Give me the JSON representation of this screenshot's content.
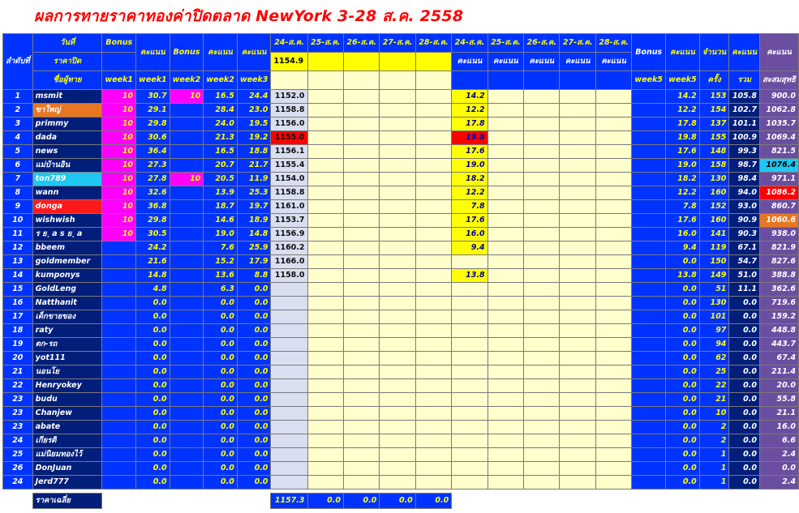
{
  "title": "ผลการทายราคาทองค่าปิดตลาด NewYork 3-28 ส.ค. 2558",
  "headers": {
    "rank": "ลำดับที่",
    "date_label": "วันที่",
    "close_price_label": "ราคาปิด",
    "member_label": "ชื่อผู้ทาย",
    "bonus": "Bonus",
    "score": "คะแนน",
    "week1": "week1",
    "week2": "week2",
    "week3": "week3",
    "week5": "week5",
    "dates": [
      "24-ส.ค.",
      "25-ส.ค.",
      "26-ส.ค.",
      "27-ส.ค.",
      "28-ส.ค."
    ],
    "close_prices": [
      "1154.9",
      "",
      "",
      "",
      ""
    ],
    "count": "จำนวน",
    "times": "ครั้ง",
    "total": "รวม",
    "cumulative": "สะสมสุทธิ"
  },
  "rows": [
    {
      "no": "1",
      "name": "msmit",
      "b1": "10",
      "w1": "30.7",
      "b2": "10",
      "w2": "16.5",
      "w3": "24.4",
      "p": "1152.0",
      "s": "14.2",
      "w5": "14.2",
      "cnt": "153",
      "tot": "105.8",
      "cum": "900.0"
    },
    {
      "no": "2",
      "name": "ขาใหญ่",
      "b1": "10",
      "w1": "29.1",
      "b2": "",
      "w2": "28.4",
      "w3": "23.0",
      "p": "1158.8",
      "s": "12.2",
      "w5": "12.2",
      "cnt": "154",
      "tot": "102.7",
      "cum": "1062.8"
    },
    {
      "no": "3",
      "name": "primmy",
      "b1": "10",
      "w1": "29.8",
      "b2": "",
      "w2": "24.0",
      "w3": "19.5",
      "p": "1156.0",
      "s": "17.8",
      "w5": "17.8",
      "cnt": "137",
      "tot": "101.1",
      "cum": "1035.7"
    },
    {
      "no": "4",
      "name": "dada",
      "b1": "10",
      "w1": "30.6",
      "b2": "",
      "w2": "21.3",
      "w3": "19.2",
      "p": "1155.0",
      "s": "19.8",
      "w5": "19.8",
      "cnt": "155",
      "tot": "100.9",
      "cum": "1069.4"
    },
    {
      "no": "5",
      "name": "news",
      "b1": "10",
      "w1": "36.4",
      "b2": "",
      "w2": "16.5",
      "w3": "18.8",
      "p": "1156.1",
      "s": "17.6",
      "w5": "17.6",
      "cnt": "148",
      "tot": "99.3",
      "cum": "821.5"
    },
    {
      "no": "6",
      "name": "แม่บ้านอิน",
      "b1": "10",
      "w1": "27.3",
      "b2": "",
      "w2": "20.7",
      "w3": "21.7",
      "p": "1155.4",
      "s": "19.0",
      "w5": "19.0",
      "cnt": "158",
      "tot": "98.7",
      "cum": "1076.4"
    },
    {
      "no": "7",
      "name": "ton789",
      "b1": "10",
      "w1": "27.8",
      "b2": "10",
      "w2": "20.5",
      "w3": "11.9",
      "p": "1154.0",
      "s": "18.2",
      "w5": "18.2",
      "cnt": "130",
      "tot": "98.4",
      "cum": "971.1"
    },
    {
      "no": "8",
      "name": "wann",
      "b1": "10",
      "w1": "32.6",
      "b2": "",
      "w2": "13.9",
      "w3": "25.3",
      "p": "1158.8",
      "s": "12.2",
      "w5": "12.2",
      "cnt": "160",
      "tot": "94.0",
      "cum": "1086.2"
    },
    {
      "no": "9",
      "name": "donga",
      "b1": "10",
      "w1": "36.8",
      "b2": "",
      "w2": "18.7",
      "w3": "19.7",
      "p": "1161.0",
      "s": "7.8",
      "w5": "7.8",
      "cnt": "152",
      "tot": "93.0",
      "cum": "860.7"
    },
    {
      "no": "10",
      "name": "wishwish",
      "b1": "10",
      "w1": "29.8",
      "b2": "",
      "w2": "14.6",
      "w3": "18.9",
      "p": "1153.7",
      "s": "17.6",
      "w5": "17.6",
      "cnt": "160",
      "tot": "90.9",
      "cum": "1060.6"
    },
    {
      "no": "11",
      "name": "ร ย ฺ a s ย ฺ a",
      "b1": "10",
      "w1": "30.5",
      "b2": "",
      "w2": "19.0",
      "w3": "14.8",
      "p": "1156.9",
      "s": "16.0",
      "w5": "16.0",
      "cnt": "141",
      "tot": "90.3",
      "cum": "938.0"
    },
    {
      "no": "12",
      "name": "bbeem",
      "b1": "",
      "w1": "24.2",
      "b2": "",
      "w2": "7.6",
      "w3": "25.9",
      "p": "1160.2",
      "s": "9.4",
      "w5": "9.4",
      "cnt": "119",
      "tot": "67.1",
      "cum": "821.9"
    },
    {
      "no": "13",
      "name": "goldmember",
      "b1": "",
      "w1": "21.6",
      "b2": "",
      "w2": "15.2",
      "w3": "17.9",
      "p": "1166.0",
      "s": "",
      "w5": "0.0",
      "cnt": "150",
      "tot": "54.7",
      "cum": "827.6"
    },
    {
      "no": "14",
      "name": "kumponys",
      "b1": "",
      "w1": "14.8",
      "b2": "",
      "w2": "13.6",
      "w3": "8.8",
      "p": "1158.0",
      "s": "13.8",
      "w5": "13.8",
      "cnt": "149",
      "tot": "51.0",
      "cum": "388.8"
    },
    {
      "no": "15",
      "name": "GoldLeng",
      "b1": "",
      "w1": "4.8",
      "b2": "",
      "w2": "6.3",
      "w3": "0.0",
      "p": "",
      "s": "",
      "w5": "0.0",
      "cnt": "51",
      "tot": "11.1",
      "cum": "362.6"
    },
    {
      "no": "16",
      "name": "Natthanit",
      "b1": "",
      "w1": "0.0",
      "b2": "",
      "w2": "0.0",
      "w3": "0.0",
      "p": "",
      "s": "",
      "w5": "0.0",
      "cnt": "130",
      "tot": "0.0",
      "cum": "719.6"
    },
    {
      "no": "17",
      "name": "เด็กขายของ",
      "b1": "",
      "w1": "0.0",
      "b2": "",
      "w2": "0.0",
      "w3": "0.0",
      "p": "",
      "s": "",
      "w5": "0.0",
      "cnt": "101",
      "tot": "0.0",
      "cum": "159.2"
    },
    {
      "no": "18",
      "name": "raty",
      "b1": "",
      "w1": "0.0",
      "b2": "",
      "w2": "0.0",
      "w3": "0.0",
      "p": "",
      "s": "",
      "w5": "0.0",
      "cnt": "97",
      "tot": "0.0",
      "cum": "448.8"
    },
    {
      "no": "19",
      "name": "ตก-รถ",
      "b1": "",
      "w1": "0.0",
      "b2": "",
      "w2": "0.0",
      "w3": "0.0",
      "p": "",
      "s": "",
      "w5": "0.0",
      "cnt": "94",
      "tot": "0.0",
      "cum": "443.7"
    },
    {
      "no": "20",
      "name": "yot111",
      "b1": "",
      "w1": "0.0",
      "b2": "",
      "w2": "0.0",
      "w3": "0.0",
      "p": "",
      "s": "",
      "w5": "0.0",
      "cnt": "62",
      "tot": "0.0",
      "cum": "67.4"
    },
    {
      "no": "21",
      "name": "นอนโย",
      "b1": "",
      "w1": "0.0",
      "b2": "",
      "w2": "0.0",
      "w3": "0.0",
      "p": "",
      "s": "",
      "w5": "0.0",
      "cnt": "25",
      "tot": "0.0",
      "cum": "211.4"
    },
    {
      "no": "22",
      "name": "Henryokey",
      "b1": "",
      "w1": "0.0",
      "b2": "",
      "w2": "0.0",
      "w3": "0.0",
      "p": "",
      "s": "",
      "w5": "0.0",
      "cnt": "22",
      "tot": "0.0",
      "cum": "20.0"
    },
    {
      "no": "23",
      "name": "budu",
      "b1": "",
      "w1": "0.0",
      "b2": "",
      "w2": "0.0",
      "w3": "0.0",
      "p": "",
      "s": "",
      "w5": "0.0",
      "cnt": "21",
      "tot": "0.0",
      "cum": "55.8"
    },
    {
      "no": "23",
      "name": "Chanjew",
      "b1": "",
      "w1": "0.0",
      "b2": "",
      "w2": "0.0",
      "w3": "0.0",
      "p": "",
      "s": "",
      "w5": "0.0",
      "cnt": "10",
      "tot": "0.0",
      "cum": "21.1"
    },
    {
      "no": "23",
      "name": "abate",
      "b1": "",
      "w1": "0.0",
      "b2": "",
      "w2": "0.0",
      "w3": "0.0",
      "p": "",
      "s": "",
      "w5": "0.0",
      "cnt": "2",
      "tot": "0.0",
      "cum": "16.0"
    },
    {
      "no": "24",
      "name": "เกียรติ",
      "b1": "",
      "w1": "0.0",
      "b2": "",
      "w2": "0.0",
      "w3": "0.0",
      "p": "",
      "s": "",
      "w5": "0.0",
      "cnt": "2",
      "tot": "0.0",
      "cum": "6.6"
    },
    {
      "no": "25",
      "name": "แม่นิยมทองไว้",
      "b1": "",
      "w1": "0.0",
      "b2": "",
      "w2": "0.0",
      "w3": "0.0",
      "p": "",
      "s": "",
      "w5": "0.0",
      "cnt": "1",
      "tot": "0.0",
      "cum": "2.4"
    },
    {
      "no": "26",
      "name": "DonJuan",
      "b1": "",
      "w1": "0.0",
      "b2": "",
      "w2": "0.0",
      "w3": "0.0",
      "p": "",
      "s": "",
      "w5": "0.0",
      "cnt": "1",
      "tot": "0.0",
      "cum": "0.0"
    },
    {
      "no": "24",
      "name": "Jerd777",
      "b1": "",
      "w1": "0.0",
      "b2": "",
      "w2": "0.0",
      "w3": "0.0",
      "p": "",
      "s": "",
      "w5": "0.0",
      "cnt": "1",
      "tot": "0.0",
      "cum": "2.4"
    }
  ],
  "footer": {
    "avg_label": "ราคาเฉลี่ย",
    "averages": [
      "1157.3",
      "0.0",
      "0.0",
      "0.0",
      "0.0"
    ]
  },
  "colors": {
    "title": "#ff0000",
    "header_bg": "#0033ff",
    "name_bg": "#001e7a",
    "bonus_bg": "#ff00ff",
    "score_highlight": "#ffff00",
    "cream": "#ffffcc",
    "cumulative_bg": "#6b4ea0",
    "highlight_red": "#ff0000",
    "highlight_cyan": "#1ec8f0",
    "highlight_orange": "#e87722"
  }
}
